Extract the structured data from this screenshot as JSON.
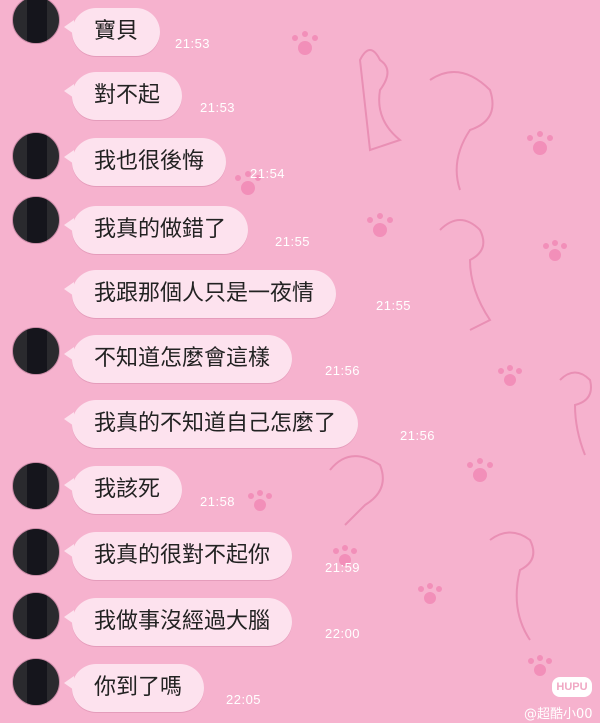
{
  "colors": {
    "background": "#f6b2ce",
    "bubble": "#fde2ee",
    "timestamp": "#ffffff"
  },
  "messages": [
    {
      "text": "寶貝",
      "time": "21:53"
    },
    {
      "text": "對不起",
      "time": "21:53"
    },
    {
      "text": "我也很後悔",
      "time": "21:54"
    },
    {
      "text": "我真的做錯了",
      "time": "21:55"
    },
    {
      "text": "我跟那個人只是一夜情",
      "time": "21:55"
    },
    {
      "text": "不知道怎麼會這樣",
      "time": "21:56"
    },
    {
      "text": "我真的不知道自己怎麼了",
      "time": "21:56"
    },
    {
      "text": "我該死",
      "time": "21:58"
    },
    {
      "text": "我真的很對不起你",
      "time": "21:59"
    },
    {
      "text": "我做事沒經過大腦",
      "time": "22:00"
    },
    {
      "text": "你到了嗎",
      "time": "22:05"
    }
  ],
  "logo_text": "HUPU",
  "watermark": "@超酷小00"
}
